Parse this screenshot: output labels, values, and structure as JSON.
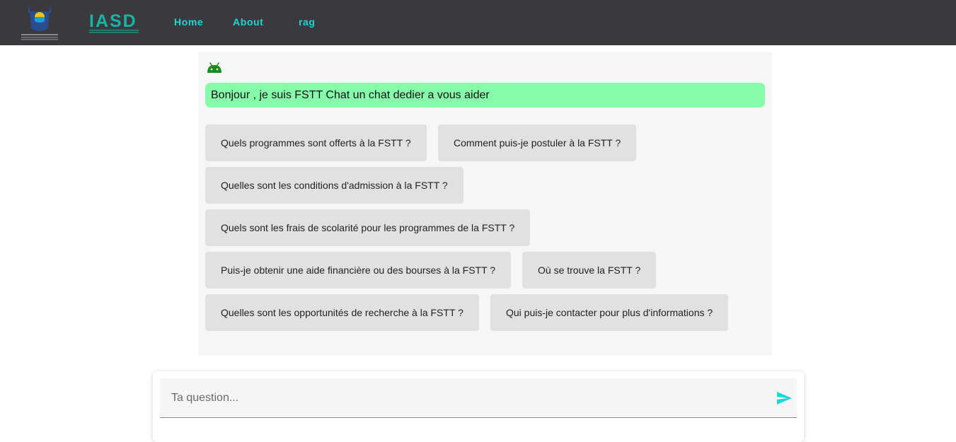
{
  "navbar": {
    "links": [
      "Home",
      "About",
      "rag"
    ],
    "logo_text": "IASD",
    "accent_color": "#1fd6d6",
    "background_color": "#3a393e"
  },
  "chat": {
    "bot_icon": "android-icon",
    "greeting": "Bonjour , je suis FSTT Chat un chat dedier a vous aider",
    "suggestions": [
      "Quels programmes sont offerts à la FSTT ?",
      "Comment puis-je postuler à la FSTT ?",
      "Quelles sont les conditions d'admission à la FSTT ?",
      "Quels sont les frais de scolarité pour les programmes de la FSTT ?",
      "Puis-je obtenir une aide financière ou des bourses à la FSTT ?",
      "Où se trouve la FSTT ?",
      "Quelles sont les opportunités de recherche à la FSTT ?",
      "Qui puis-je contacter pour plus d'informations ?"
    ]
  },
  "input": {
    "placeholder": "Ta question...",
    "send_icon": "send-icon"
  }
}
